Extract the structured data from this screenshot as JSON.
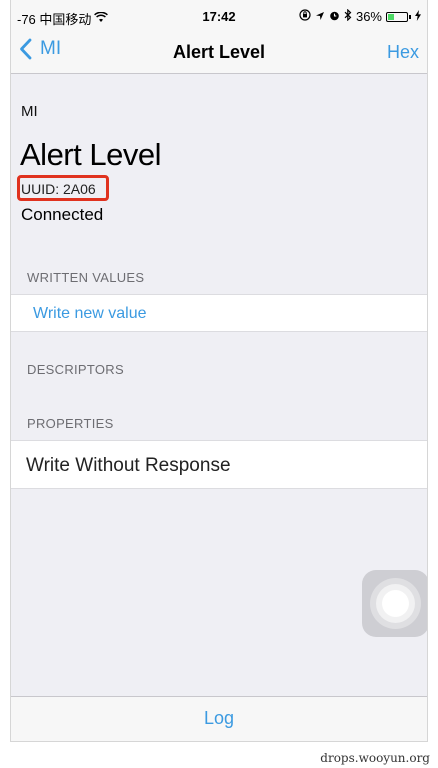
{
  "status_bar": {
    "carrier": "-76 中国移动",
    "time": "17:42",
    "battery_percent": "36%",
    "battery_level": 0.36
  },
  "nav": {
    "back_label": "MI",
    "title": "Alert Level",
    "right_label": "Hex"
  },
  "header": {
    "device_name": "MI",
    "characteristic_name": "Alert Level",
    "uuid": "UUID: 2A06",
    "status": "Connected"
  },
  "sections": {
    "written_values": {
      "title": "WRITTEN VALUES",
      "action": "Write new value"
    },
    "descriptors": {
      "title": "DESCRIPTORS"
    },
    "properties": {
      "title": "PROPERTIES",
      "items": [
        "Write Without Response"
      ]
    }
  },
  "toolbar": {
    "log_label": "Log"
  },
  "watermark": "drops.wooyun.org",
  "colors": {
    "accent": "#3b9ae1",
    "highlight": "#e0321f",
    "background": "#efeff4"
  }
}
